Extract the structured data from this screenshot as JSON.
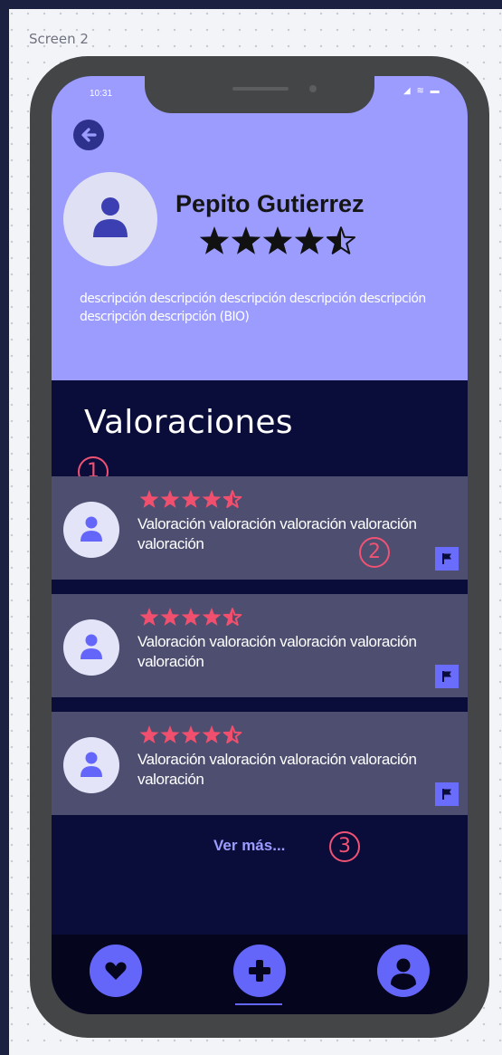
{
  "canvas": {
    "label": "Screen 2"
  },
  "status_bar": {
    "time": "10:31",
    "icons": "◢ ≋ ▬"
  },
  "profile": {
    "back_icon": "arrow-left-icon",
    "avatar_icon": "user-icon",
    "name": "Pepito Gutierrez",
    "rating": 4.5,
    "bio": "descripción descripción descripción descripción descripción descripción descripción (BIO)"
  },
  "reviews_section": {
    "title": "Valoraciones",
    "items": [
      {
        "rating": 4.5,
        "text": "Valoración valoración valoración valoración valoración",
        "flag_icon": "flag-icon"
      },
      {
        "rating": 4.5,
        "text": "Valoración valoración valoración valoración valoración",
        "flag_icon": "flag-icon"
      },
      {
        "rating": 4.5,
        "text": "Valoración valoración valoración valoración valoración",
        "flag_icon": "flag-icon"
      }
    ],
    "see_more": "Ver más..."
  },
  "annotations": [
    "1",
    "2",
    "3"
  ],
  "bottom_nav": {
    "items": [
      {
        "icon": "heart-icon"
      },
      {
        "icon": "plus-icon"
      },
      {
        "icon": "user-icon"
      }
    ]
  },
  "colors": {
    "profile_bg": "#9b9cfe",
    "screen_bg": "#0a0c3a",
    "card_bg": "#4d4e70",
    "star_profile": "#111111",
    "star_review": "#f0506e",
    "accent": "#6466f9",
    "annotation": "#f05274"
  }
}
